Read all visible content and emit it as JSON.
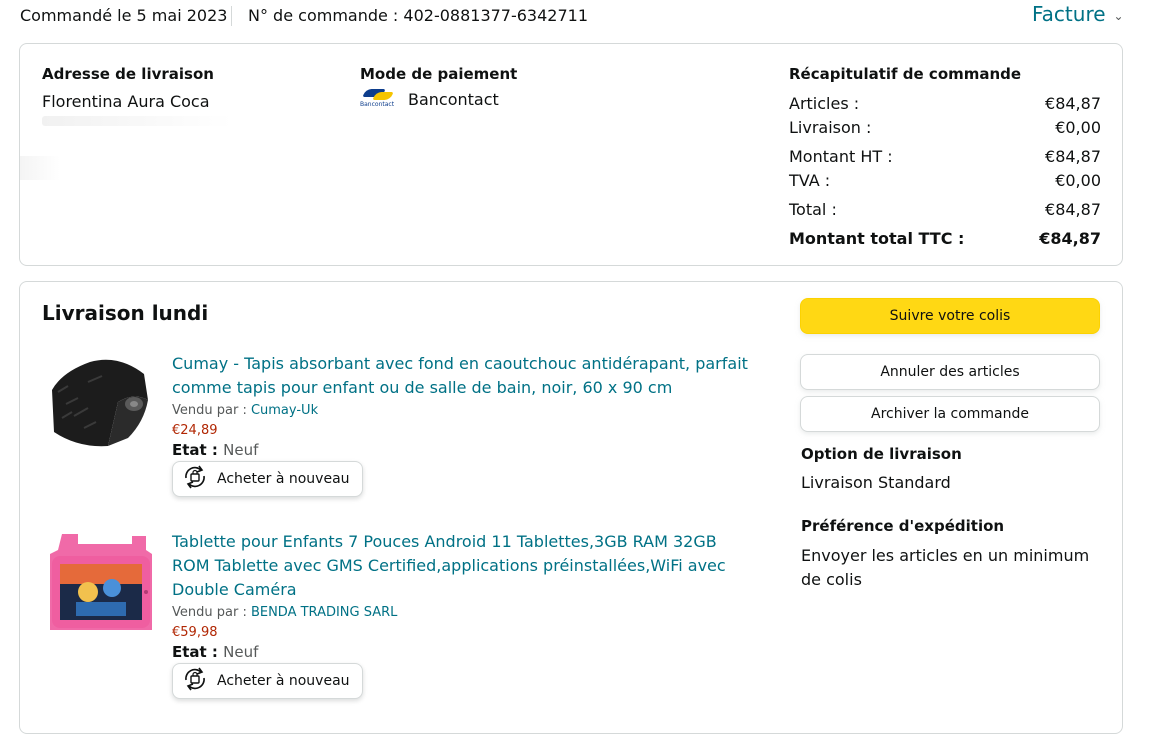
{
  "header": {
    "ordered_on": "Commandé le 5 mai 2023",
    "order_number": "N° de commande : 402-0881377-6342711",
    "invoice_label": "Facture"
  },
  "shipping_address": {
    "title": "Adresse de livraison",
    "name": "Florentina Aura Coca"
  },
  "payment": {
    "title": "Mode de paiement",
    "method": "Bancontact",
    "logo_text": "Bancontact"
  },
  "summary": {
    "title": "Récapitulatif de commande",
    "rows": [
      {
        "label": "Articles :",
        "value": "€84,87"
      },
      {
        "label": "Livraison :",
        "value": "€0,00"
      },
      {
        "label": "Montant HT :",
        "value": "€84,87"
      },
      {
        "label": "TVA :",
        "value": "€0,00"
      },
      {
        "label": "Total :",
        "value": "€84,87"
      },
      {
        "label": "Montant total TTC :",
        "value": "€84,87"
      }
    ]
  },
  "delivery": {
    "title": "Livraison lundi",
    "items": [
      {
        "title": "Cumay - Tapis absorbant avec fond en caoutchouc antidérapant, parfait comme tapis pour enfant ou de salle de bain, noir, 60 x 90 cm",
        "sold_by_label": "Vendu par : ",
        "seller": "Cumay-Uk",
        "price": "€24,89",
        "state_label": "Etat : ",
        "state": "Neuf",
        "rebuy_label": "Acheter à nouveau"
      },
      {
        "title": "Tablette pour Enfants 7 Pouces Android 11 Tablettes,3GB RAM 32GB ROM Tablette avec GMS Certified,applications préinstallées,WiFi avec Double Caméra",
        "sold_by_label": "Vendu par : ",
        "seller": "BENDA TRADING SARL",
        "price": "€59,98",
        "state_label": "Etat : ",
        "state": "Neuf",
        "rebuy_label": "Acheter à nouveau"
      }
    ]
  },
  "actions": {
    "track": "Suivre votre colis",
    "cancel": "Annuler des articles",
    "archive": "Archiver la commande"
  },
  "shipping_option": {
    "title": "Option de livraison",
    "value": "Livraison Standard"
  },
  "shipping_preference": {
    "title": "Préférence d'expédition",
    "value": "Envoyer les articles en un minimum de colis"
  },
  "colors": {
    "link": "#007185",
    "price": "#B12704",
    "primary_button": "#FFD814"
  }
}
